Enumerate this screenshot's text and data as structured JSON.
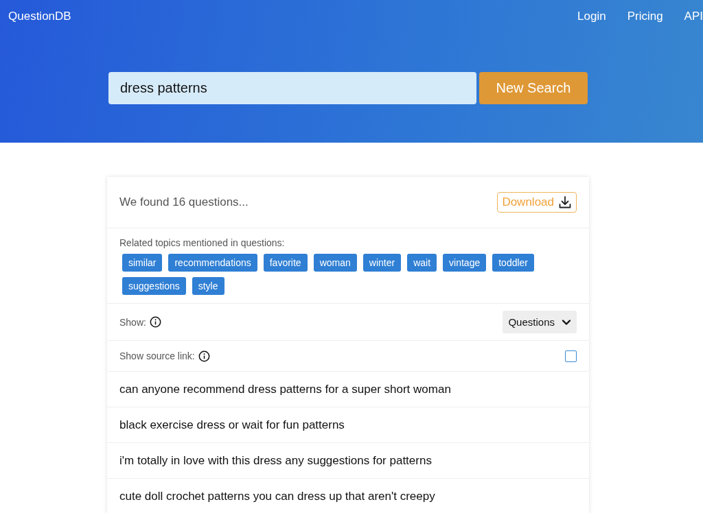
{
  "header": {
    "logo": "QuestionDB",
    "nav": [
      "Login",
      "Pricing",
      "API"
    ]
  },
  "search": {
    "value": "dress patterns",
    "button": "New Search"
  },
  "results": {
    "summary": "We found 16 questions...",
    "download": "Download",
    "topics_label": "Related topics mentioned in questions:",
    "topics": [
      "similar",
      "recommendations",
      "favorite",
      "woman",
      "winter",
      "wait",
      "vintage",
      "toddler",
      "suggestions",
      "style"
    ],
    "show_label": "Show:",
    "show_value": "Questions",
    "source_label": "Show source link:",
    "source_checked": false,
    "questions": [
      "can anyone recommend dress patterns for a super short woman",
      "black exercise dress or wait for fun patterns",
      "i'm totally in love with this dress any suggestions for patterns",
      "cute doll crochet patterns you can dress up that aren't creepy"
    ]
  }
}
